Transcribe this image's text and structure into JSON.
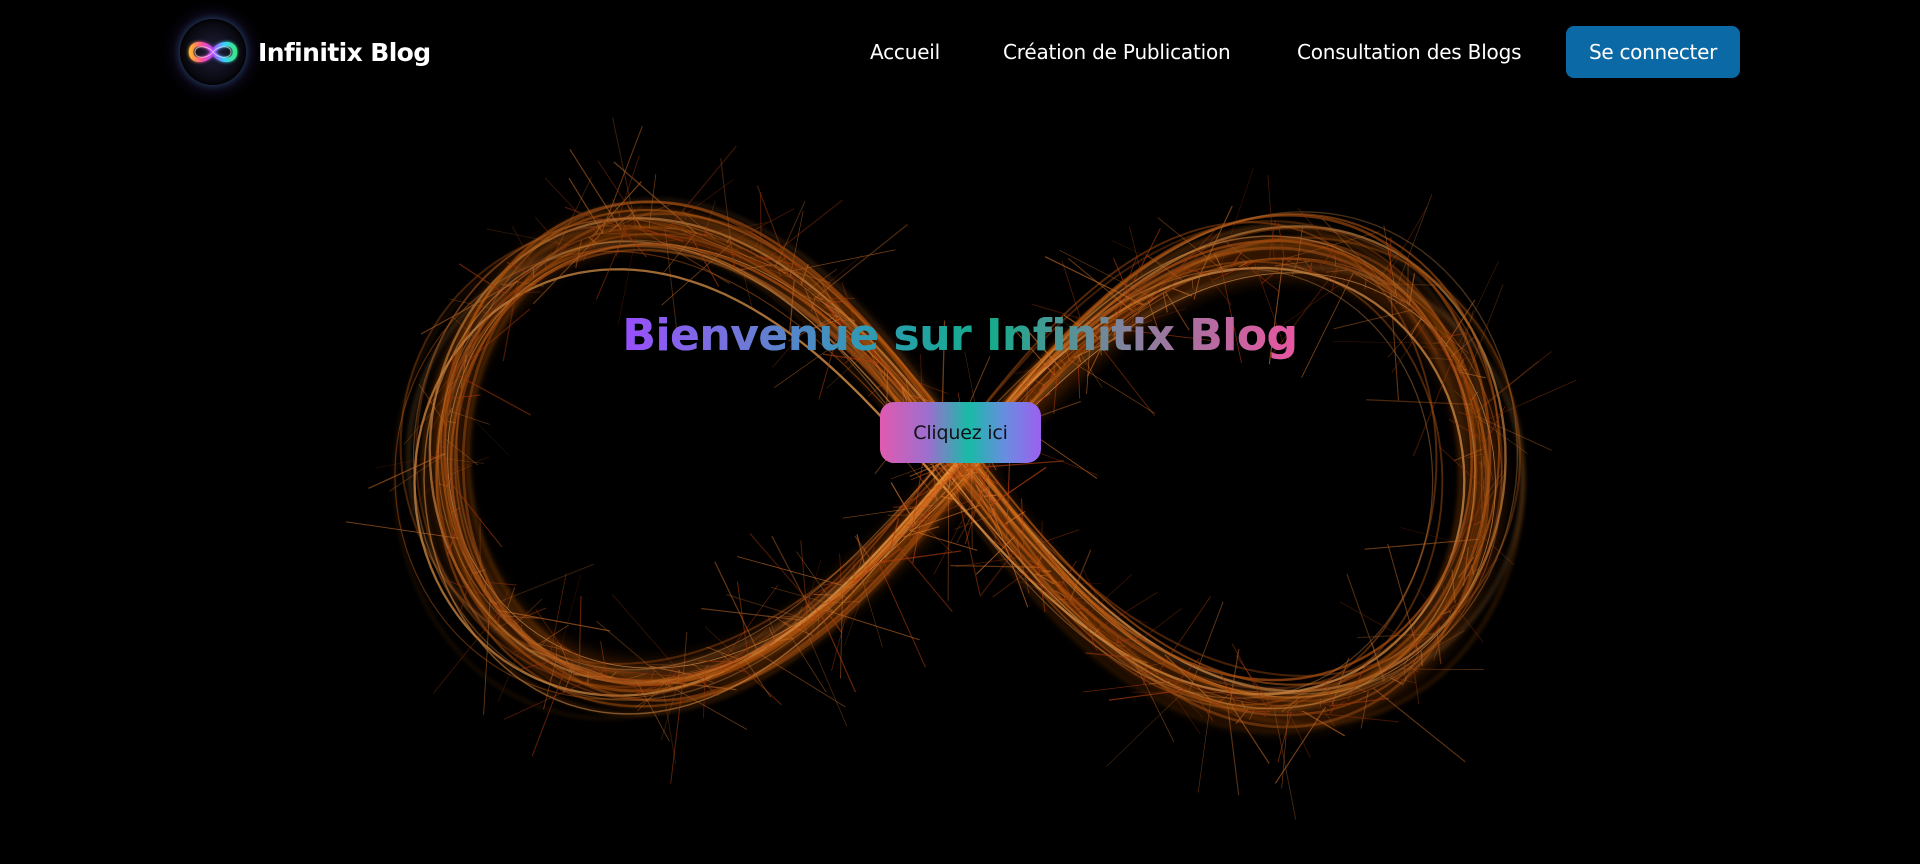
{
  "brand": {
    "name": "Infinitix Blog",
    "logo_icon": "rainbow-infinity-icon"
  },
  "nav": {
    "items": [
      {
        "label": "Accueil"
      },
      {
        "label": "Création de Publication"
      },
      {
        "label": "Consultation des Blogs"
      }
    ],
    "login_label": "Se connecter"
  },
  "hero": {
    "title": "Bienvenue sur Infinitix Blog",
    "cta_label": "Cliquez ici",
    "background_icon": "sparkler-infinity-icon"
  },
  "colors": {
    "background": "#000000",
    "login_button": "#0b6aa5",
    "sparkle": "#d96a18"
  }
}
